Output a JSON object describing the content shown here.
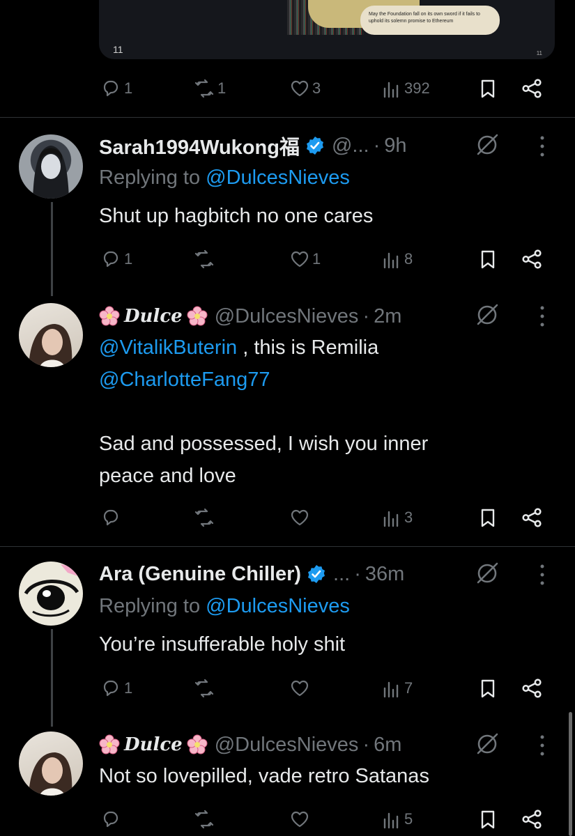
{
  "top_card": {
    "caption": "May the Foundation fall on its own sword if it fails to uphold its solemn promise to Ethereum",
    "counter": "11",
    "counter_small": "11"
  },
  "top_actions": {
    "replies": "1",
    "reposts": "1",
    "likes": "3",
    "views": "392"
  },
  "posts": [
    {
      "name": "Sarah1994Wukong福",
      "verified": true,
      "handle": "@...",
      "time": "9h",
      "replying_prefix": "Replying to",
      "replying_to": "@DulcesNieves",
      "text": "Shut up hagbitch no one cares",
      "actions": {
        "replies": "1",
        "reposts": "",
        "likes": "1",
        "views": "8"
      }
    },
    {
      "name": "Dulce",
      "handle": "@DulcesNieves",
      "time": "2m",
      "mention1": "@VitalikButerin",
      "line1_rest": " , this is Remilia",
      "mention2": "@CharlotteFang77",
      "line3": "Sad and possessed, I wish you inner",
      "line4": "peace and love",
      "actions": {
        "replies": "",
        "reposts": "",
        "likes": "",
        "views": "3"
      }
    },
    {
      "name": "Ara (Genuine Chiller)",
      "verified": true,
      "handle": "...",
      "time": "36m",
      "replying_prefix": "Replying to",
      "replying_to": "@DulcesNieves",
      "text": "You’re insufferable holy shit",
      "actions": {
        "replies": "1",
        "reposts": "",
        "likes": "",
        "views": "7"
      }
    },
    {
      "name": "Dulce",
      "handle": "@DulcesNieves",
      "time": "6m",
      "text": "Not so lovepilled, vade retro Satanas",
      "actions": {
        "replies": "",
        "reposts": "",
        "likes": "",
        "views": "5"
      }
    }
  ],
  "colors": {
    "background": "#000000",
    "text": "#e7e9ea",
    "muted": "#71767b",
    "accent": "#1d9bf0",
    "divider": "#2f3336"
  }
}
